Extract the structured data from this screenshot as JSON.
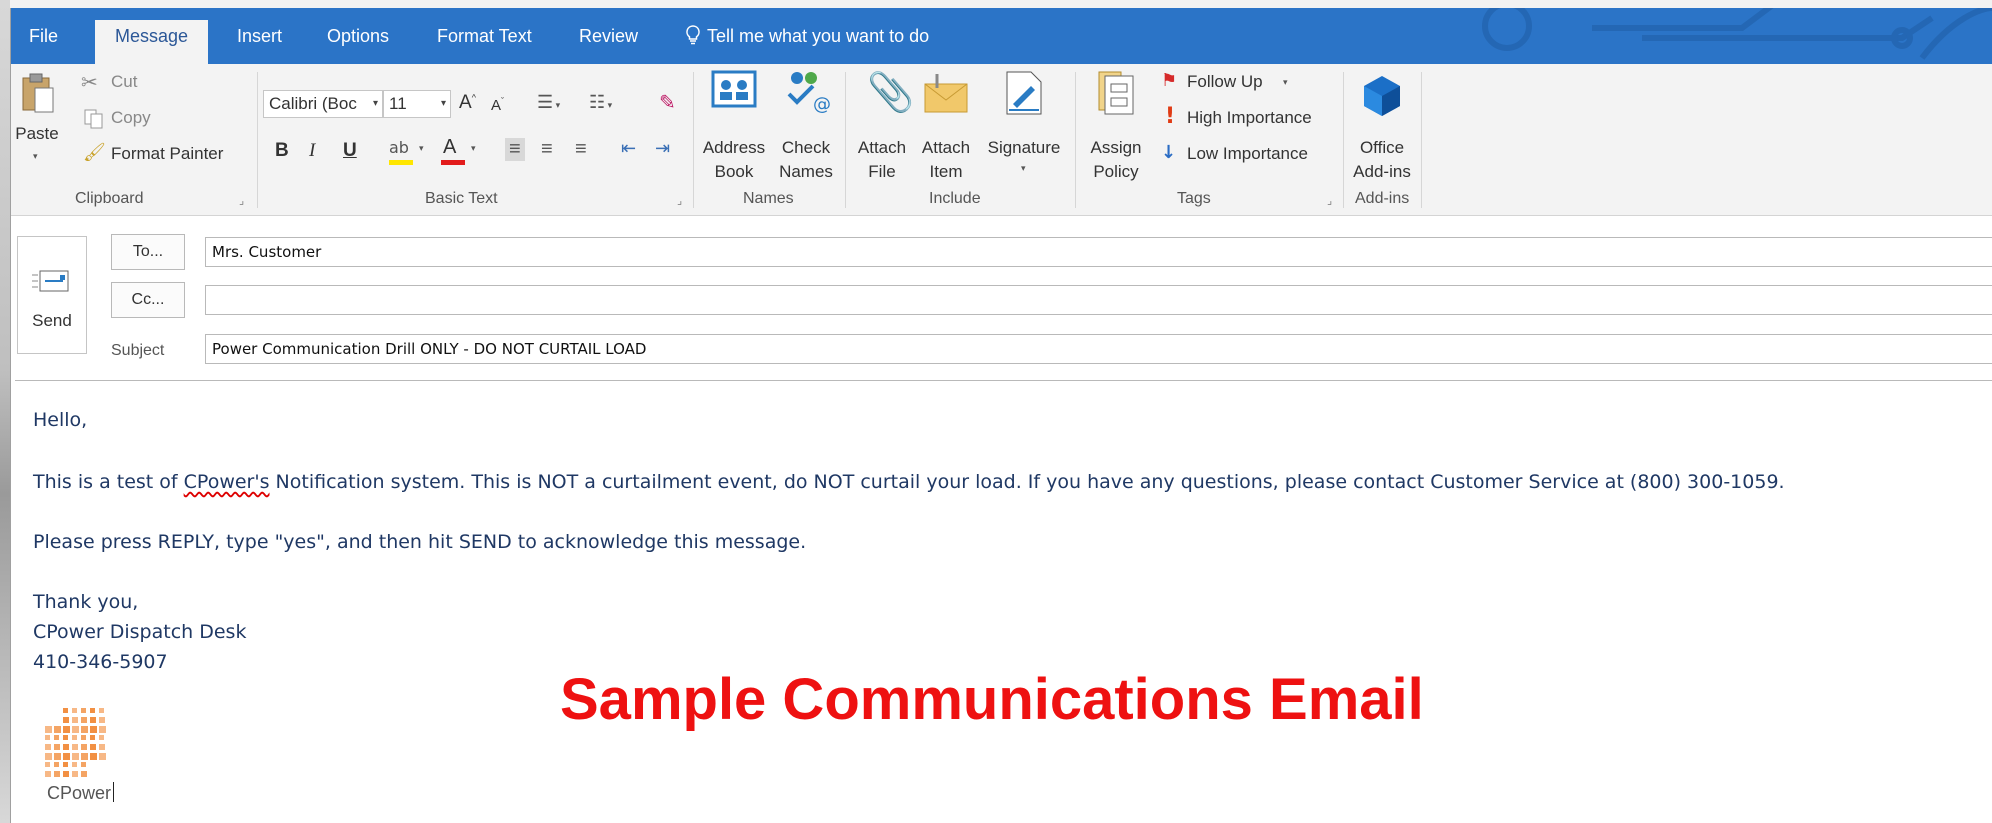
{
  "tabs": [
    "File",
    "Message",
    "Insert",
    "Options",
    "Format Text",
    "Review"
  ],
  "tell_me": "Tell me what you want to do",
  "clipboard": {
    "paste": "Paste",
    "cut": "Cut",
    "copy": "Copy",
    "format_painter": "Format Painter",
    "group": "Clipboard"
  },
  "basic_text": {
    "font": "Calibri (Boc",
    "size": "11",
    "bold": "B",
    "italic": "I",
    "underline": "U",
    "group": "Basic Text"
  },
  "names": {
    "address_book": [
      "Address",
      "Book"
    ],
    "check_names": [
      "Check",
      "Names"
    ],
    "group": "Names"
  },
  "include": {
    "attach_file": [
      "Attach",
      "File"
    ],
    "attach_item": [
      "Attach",
      "Item"
    ],
    "signature": "Signature",
    "group": "Include"
  },
  "tags": {
    "assign_policy": [
      "Assign",
      "Policy"
    ],
    "follow_up": "Follow Up",
    "high_importance": "High Importance",
    "low_importance": "Low Importance",
    "group": "Tags"
  },
  "addins": {
    "office": [
      "Office",
      "Add-ins"
    ],
    "group": "Add-ins"
  },
  "header": {
    "send": "Send",
    "to_button": "To...",
    "cc_button": "Cc...",
    "subject_label": "Subject",
    "to_value": "Mrs. Customer",
    "cc_value": "",
    "subject_value": "Power Communication Drill ONLY - DO NOT CURTAIL LOAD"
  },
  "message": {
    "greeting": "Hello,",
    "line1_pre": "This is a test of ",
    "line1_misspelled": "CPower's",
    "line1_post": " Notification system.  This is NOT a curtailment event, do NOT curtail your load.  If you have any questions, please contact Customer Service at (800) 300-1059.",
    "line2": "Please press REPLY, type \"yes\", and then hit SEND to acknowledge this message.",
    "thanks": "Thank you,",
    "signature_name": "CPower Dispatch Desk",
    "signature_phone": "410-346-5907",
    "logo_text": "CPower"
  },
  "banner": "Sample Communications Email",
  "colors": {
    "tabbar": "#2b74c7",
    "banner": "#ee1111",
    "body_text": "#1f3864",
    "logo_orange": "#f07d22"
  }
}
